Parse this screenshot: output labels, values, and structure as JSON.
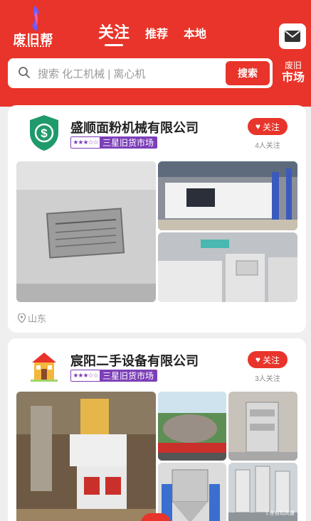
{
  "app": {
    "logo_text": "废旧帮"
  },
  "header": {
    "tabs": [
      {
        "label": "关注",
        "active": true
      },
      {
        "label": "推荐",
        "active": false
      },
      {
        "label": "本地",
        "active": false
      }
    ],
    "message_icon": "mail-icon"
  },
  "search": {
    "placeholder": "搜索 化工机械 | 离心机",
    "button_label": "搜索"
  },
  "market_link": {
    "line1": "废旧",
    "line2": "市场"
  },
  "colors": {
    "brand_red": "#e8342a",
    "badge_purple": "#7c3fb8"
  },
  "feed": [
    {
      "company_name": "盛顺面粉机械有限公司",
      "rating_stars": "★★★☆☆",
      "rating_label": "三星旧货市场",
      "follow_label": "关注",
      "follow_count": "4人关注",
      "location": "山东",
      "logo_icon": "dollar-shield-icon"
    },
    {
      "company_name": "宸阳二手设备有限公司",
      "rating_stars": "★★★☆☆",
      "rating_label": "三星旧货市场",
      "follow_label": "关注",
      "follow_count": "3人关注",
      "logo_icon": "house-icon",
      "photo_caption": "1.全自动高速"
    }
  ]
}
